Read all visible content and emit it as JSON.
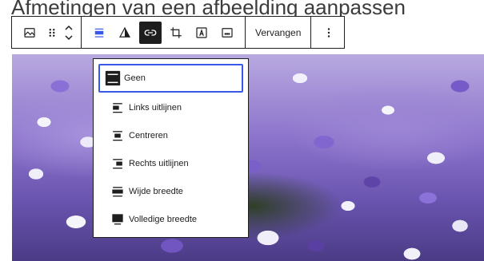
{
  "page": {
    "title": "Afmetingen van een afbeelding aanpassen"
  },
  "toolbar": {
    "replace_label": "Vervangen"
  },
  "alignment_menu": {
    "items": [
      {
        "label": "Geen",
        "icon": "align-none-icon",
        "selected": true
      },
      {
        "label": "Links uitlijnen",
        "icon": "align-left-icon",
        "selected": false
      },
      {
        "label": "Centreren",
        "icon": "align-center-icon",
        "selected": false
      },
      {
        "label": "Rechts uitlijnen",
        "icon": "align-right-icon",
        "selected": false
      },
      {
        "label": "Wijde breedte",
        "icon": "align-wide-icon",
        "selected": false
      },
      {
        "label": "Volledige breedte",
        "icon": "align-full-width-icon",
        "selected": false
      }
    ]
  },
  "colors": {
    "accent": "#3858e9",
    "border": "#1e1e1e"
  }
}
